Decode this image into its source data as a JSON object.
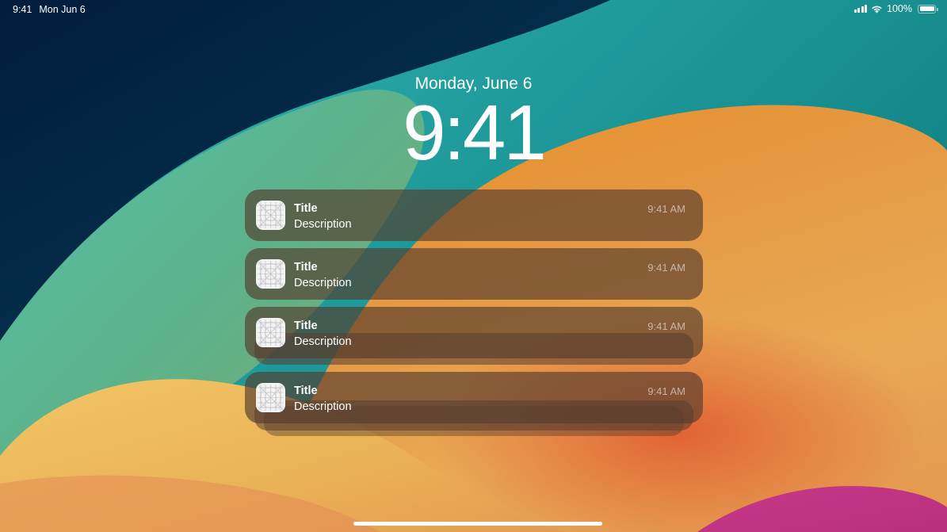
{
  "status_bar": {
    "time": "9:41",
    "date": "Mon Jun 6",
    "battery_text": "100%",
    "battery_level": 1.0,
    "signal_icon": "cellular-signal-icon",
    "wifi_icon": "wifi-icon",
    "battery_icon": "battery-icon"
  },
  "lock_screen": {
    "date": "Monday, June 6",
    "time": "9:41"
  },
  "notifications": [
    {
      "title": "Title",
      "description": "Description",
      "time": "9:41 AM",
      "icon": "app-icon-placeholder"
    },
    {
      "title": "Title",
      "description": "Description",
      "time": "9:41 AM",
      "icon": "app-icon-placeholder"
    },
    {
      "title": "Title",
      "description": "Description",
      "time": "9:41 AM",
      "icon": "app-icon-placeholder"
    },
    {
      "title": "Title",
      "description": "Description",
      "time": "9:41 AM",
      "icon": "app-icon-placeholder"
    }
  ],
  "colors": {
    "text": "#ffffff",
    "notification_bg": "#553c2d",
    "wallpaper_teal": "#1f8f90",
    "wallpaper_navy": "#062849",
    "wallpaper_orange": "#e8a04a",
    "wallpaper_magenta": "#c2368a"
  }
}
